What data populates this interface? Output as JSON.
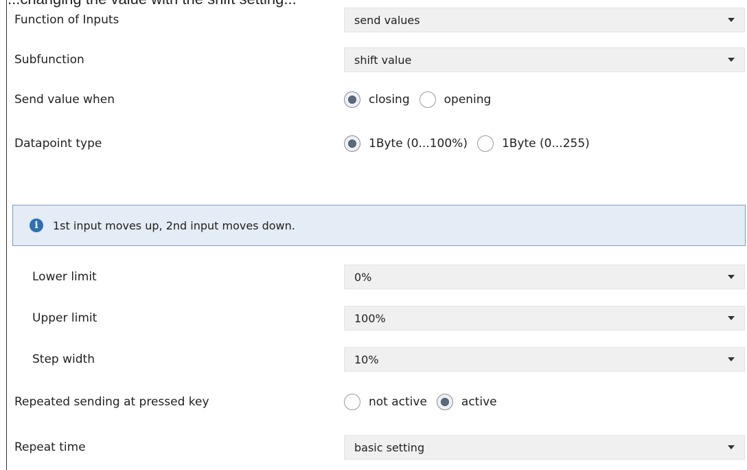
{
  "doc_fragment": "...changing the value with the shift setting...",
  "rows": {
    "function_inputs": {
      "label": "Function of Inputs",
      "value": "send values"
    },
    "subfunction": {
      "label": "Subfunction",
      "value": "shift value"
    },
    "send_value_when": {
      "label": "Send value when",
      "options": [
        {
          "label": "closing",
          "checked": true
        },
        {
          "label": "opening",
          "checked": false
        }
      ]
    },
    "datapoint_type": {
      "label": "Datapoint type",
      "options": [
        {
          "label": "1Byte (0...100%)",
          "checked": true
        },
        {
          "label": "1Byte (0...255)",
          "checked": false
        }
      ]
    },
    "info": {
      "text": "1st input moves up, 2nd input moves down.",
      "icon": "info-icon"
    },
    "lower_limit": {
      "label": "Lower limit",
      "value": "0%"
    },
    "upper_limit": {
      "label": "Upper limit",
      "value": "100%"
    },
    "step_width": {
      "label": "Step width",
      "value": "10%"
    },
    "repeated_sending": {
      "label": "Repeated sending at pressed key",
      "options": [
        {
          "label": "not active",
          "checked": false
        },
        {
          "label": "active",
          "checked": true
        }
      ]
    },
    "repeat_time": {
      "label": "Repeat time",
      "value": "basic setting"
    }
  },
  "colors": {
    "info_bg": "#e4ecf5",
    "info_border": "#7f9ab8",
    "info_icon": "#2f6fb5",
    "select_bg": "#f0f0f0"
  }
}
